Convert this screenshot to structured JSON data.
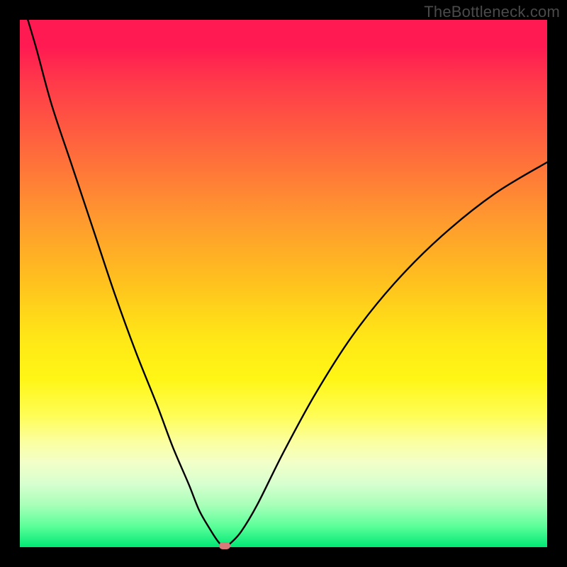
{
  "watermark": "TheBottleneck.com",
  "marker": {
    "x_frac": 0.388,
    "y_frac": 0.997,
    "color": "#d97a7a"
  },
  "chart_data": {
    "type": "line",
    "title": "",
    "xlabel": "",
    "ylabel": "",
    "xlim": [
      0,
      100
    ],
    "ylim": [
      0,
      100
    ],
    "series": [
      {
        "name": "bottleneck-curve",
        "x": [
          0,
          3,
          6,
          10,
          14,
          18,
          22,
          26,
          29,
          32,
          34,
          36,
          37.5,
          38.8,
          40,
          42,
          45,
          50,
          56,
          63,
          71,
          80,
          90,
          100
        ],
        "values": [
          105,
          95,
          84,
          72,
          60,
          48,
          37,
          27,
          19,
          12,
          7,
          3.5,
          1.2,
          0,
          0.8,
          3,
          8,
          18,
          29,
          40,
          50,
          59,
          67,
          73
        ]
      }
    ],
    "annotations": [
      {
        "text": "TheBottleneck.com",
        "position": "top-right"
      }
    ]
  }
}
